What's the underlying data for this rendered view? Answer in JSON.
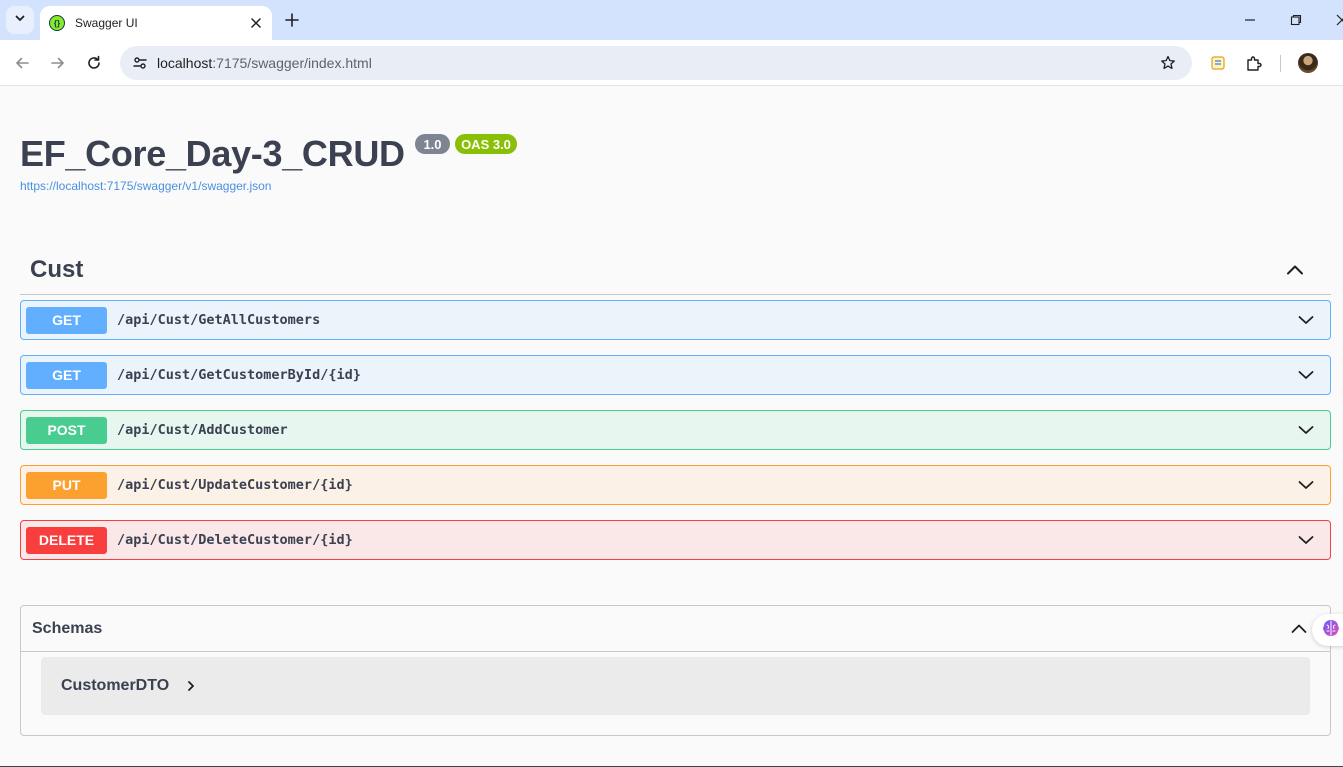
{
  "browser": {
    "tab_title": "Swagger UI",
    "url_host": "localhost",
    "url_path": ":7175/swagger/index.html"
  },
  "info": {
    "title": "EF_Core_Day-3_CRUD",
    "version": "1.0",
    "oas": "OAS 3.0",
    "spec_url": "https://localhost:7175/swagger/v1/swagger.json"
  },
  "tag": {
    "name": "Cust"
  },
  "operations": [
    {
      "method": "GET",
      "path": "/api/Cust/GetAllCustomers",
      "color": "#61affe"
    },
    {
      "method": "GET",
      "path": "/api/Cust/GetCustomerById/{id}",
      "color": "#61affe"
    },
    {
      "method": "POST",
      "path": "/api/Cust/AddCustomer",
      "color": "#49cc90"
    },
    {
      "method": "PUT",
      "path": "/api/Cust/UpdateCustomer/{id}",
      "color": "#fca130"
    },
    {
      "method": "DELETE",
      "path": "/api/Cust/DeleteCustomer/{id}",
      "color": "#f93e3e"
    }
  ],
  "schemas": {
    "title": "Schemas",
    "models": [
      {
        "name": "CustomerDTO"
      }
    ]
  },
  "icons": {
    "tab_search": "chevron-down-icon",
    "extension_side": "brain-icon"
  }
}
